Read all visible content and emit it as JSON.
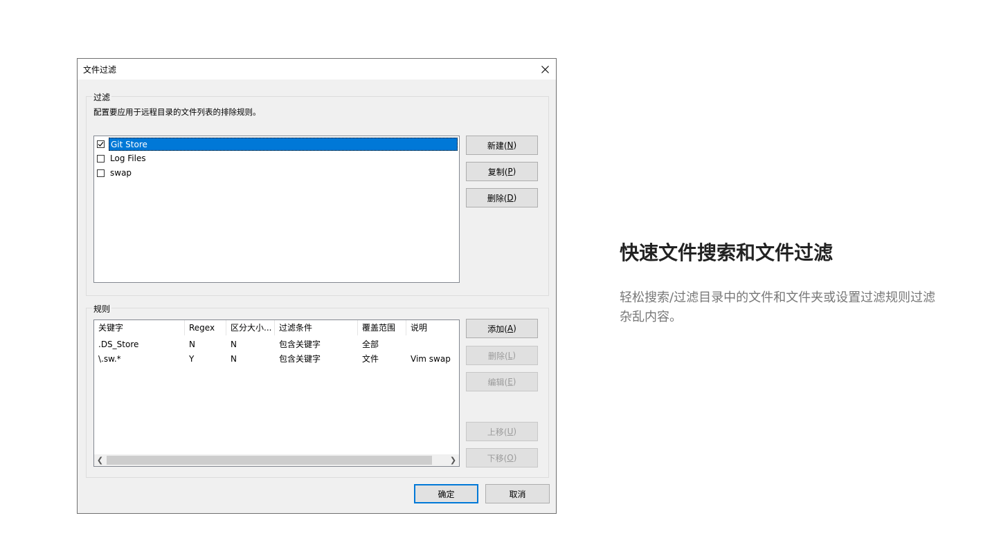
{
  "dialog": {
    "title": "文件过滤",
    "filter_group": {
      "legend": "过滤",
      "description": "配置要应用于远程目录的文件列表的排除规则。",
      "items": [
        {
          "label": "Git Store",
          "checked": true,
          "selected": true
        },
        {
          "label": "Log Files",
          "checked": false,
          "selected": false
        },
        {
          "label": "swap",
          "checked": false,
          "selected": false
        }
      ],
      "buttons": {
        "new": {
          "label": "新建(",
          "key": "N",
          "end": ")"
        },
        "copy": {
          "label": "复制(",
          "key": "P",
          "end": ")"
        },
        "delete": {
          "label": "删除(",
          "key": "D",
          "end": ")"
        }
      }
    },
    "rules_group": {
      "legend": "规则",
      "columns": [
        "关键字",
        "Regex",
        "区分大小...",
        "过滤条件",
        "覆盖范围",
        "说明"
      ],
      "rows": [
        [
          ".DS_Store",
          "N",
          "N",
          "包含关键字",
          "全部",
          ""
        ],
        [
          "\\.sw.*",
          "Y",
          "N",
          "包含关键字",
          "文件",
          "Vim swap"
        ]
      ],
      "buttons": {
        "add": {
          "label": "添加(",
          "key": "A",
          "end": ")"
        },
        "remove": {
          "label": "删除(",
          "key": "L",
          "end": ")"
        },
        "edit": {
          "label": "编辑(",
          "key": "E",
          "end": ")"
        },
        "up": {
          "label": "上移(",
          "key": "U",
          "end": ")"
        },
        "down": {
          "label": "下移(",
          "key": "O",
          "end": ")"
        }
      }
    },
    "ok_label": "确定",
    "cancel_label": "取消"
  },
  "promo": {
    "title": "快速文件搜索和文件过滤",
    "description": "轻松搜索/过滤目录中的文件和文件夹或设置过滤规则过滤杂乱内容。"
  },
  "colors": {
    "selection": "#0078d7",
    "dialog_bg": "#f0f0f0"
  }
}
